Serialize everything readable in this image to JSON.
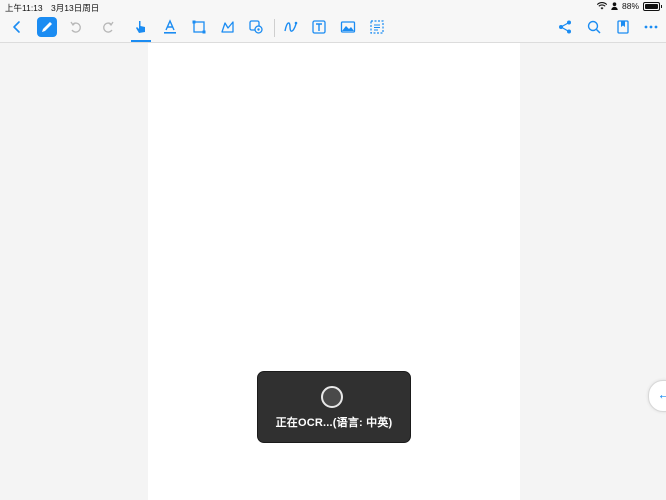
{
  "status_bar": {
    "time": "上午11:13",
    "date": "3月13日周日",
    "battery_percent": "88%",
    "battery_level": 0.88
  },
  "toolbar": {
    "left_tools": [
      "back-icon",
      "pen-icon",
      "undo-icon",
      "redo-icon",
      "hand-pointer-icon",
      "highlighter-icon",
      "rectangle-select-icon",
      "lasso-icon",
      "shape-gear-icon"
    ],
    "right_tools": [
      "curve-pen-icon",
      "text-box-icon",
      "image-icon",
      "dotted-select-icon"
    ],
    "far_right": [
      "share-icon",
      "search-icon",
      "bookmark-icon",
      "more-icon"
    ],
    "active_color": "#1b8cf2"
  },
  "ocr_toast": {
    "message": "正在OCR...(语言: 中英)"
  },
  "side_panel_tab": {
    "icon": "←"
  }
}
